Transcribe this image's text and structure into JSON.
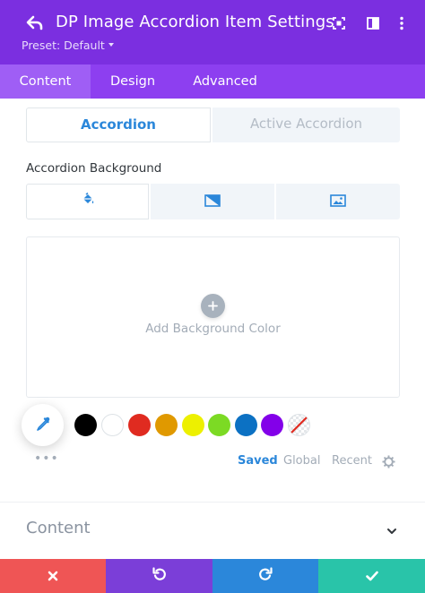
{
  "header": {
    "title": "DP Image Accordion Item Settings",
    "preset": "Preset: Default",
    "icons": [
      "back-arrow-icon",
      "expand-icon",
      "sidebar-layout-icon",
      "more-vertical-icon"
    ]
  },
  "tabs": [
    {
      "label": "Content",
      "active": true
    },
    {
      "label": "Design",
      "active": false
    },
    {
      "label": "Advanced",
      "active": false
    }
  ],
  "state_tabs": {
    "normal": "Accordion",
    "active": "Active Accordion"
  },
  "background": {
    "label": "Accordion Background",
    "types": [
      "paint-bucket-icon",
      "gradient-icon",
      "image-icon"
    ],
    "add_color_label": "Add Background Color"
  },
  "palette": {
    "colors": [
      "#000000",
      "#ffffff",
      "#e02b20",
      "#e09900",
      "#edf000",
      "#7cda24",
      "#0c71c3",
      "#8300e9"
    ],
    "tabs": [
      "Saved",
      "Global",
      "Recent"
    ],
    "active_tab": "Saved"
  },
  "section": {
    "label": "Content"
  },
  "colors": {
    "header_bg": "#7b2fe0",
    "tabs_bg": "#8d3ff0",
    "accent_blue": "#2b87da",
    "footer_cancel": "#ef5555",
    "footer_undo": "#7b3ed8",
    "footer_redo": "#2b87da",
    "footer_save": "#29c4a9"
  }
}
